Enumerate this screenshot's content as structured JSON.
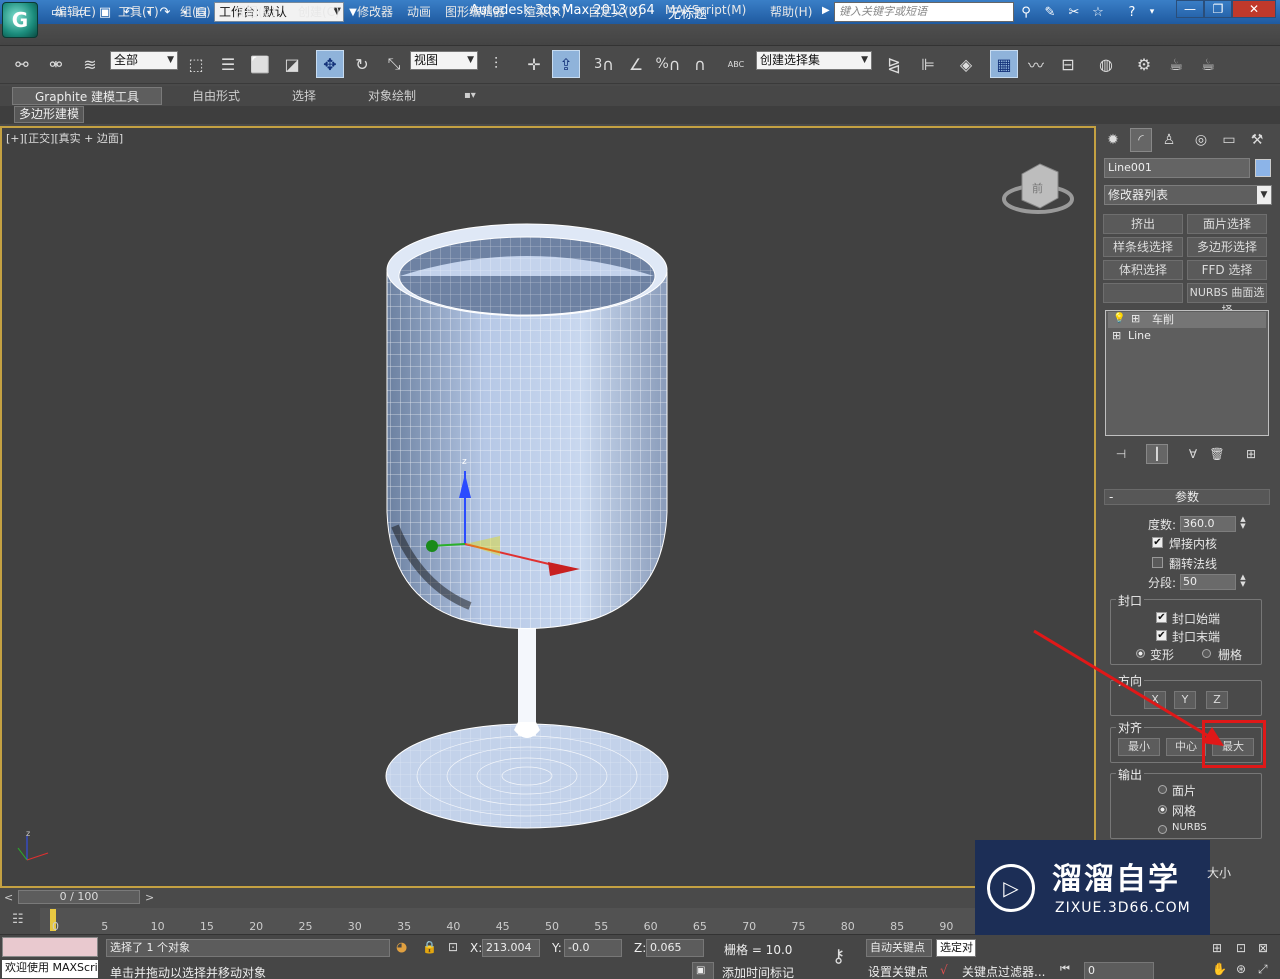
{
  "app": {
    "title": "Autodesk 3ds Max  2013 x64",
    "doc": "无标题",
    "workspace": "工作台: 默认",
    "search_placeholder": "键入关键字或短语",
    "logo": "G"
  },
  "menu": [
    "编辑(E)",
    "工具(T)",
    "组(G)",
    "视图(V)",
    "创建(C)",
    "修改器",
    "动画",
    "图形编辑器",
    "渲染(R)",
    "自定义(U)",
    "MAXScript(M)",
    "帮助(H)"
  ],
  "toolbar": {
    "filter": "全部",
    "coord": "视图",
    "selset": "创建选择集",
    "snap3": "3",
    "percent": "%",
    "spinner_snap": "ABC"
  },
  "ribbon": {
    "tabs": [
      "Graphite 建模工具",
      "自由形式",
      "选择",
      "对象绘制"
    ],
    "sub": "多边形建模",
    "extra": "▪▾"
  },
  "viewport": {
    "label": "[+][正交][真实 + 边面]",
    "viewcube": "前"
  },
  "panel": {
    "object_name": "Line001",
    "modifier_list": "修改器列表",
    "mod_buttons": [
      "挤出",
      "面片选择",
      "样条线选择",
      "多边形选择",
      "体积选择",
      "FFD 选择",
      "",
      "NURBS 曲面选择"
    ],
    "stack": [
      "车削",
      "Line"
    ],
    "rollout": "参数",
    "rollout_toggle": "-",
    "degrees_label": "度数:",
    "degrees": "360.0",
    "weld_core": "焊接内核",
    "flip_normals": "翻转法线",
    "segments_label": "分段:",
    "segments": "50",
    "capping": "封口",
    "cap_start": "封口始端",
    "cap_end": "封口末端",
    "morph": "变形",
    "grid": "栅格",
    "direction": "方向",
    "dir_x": "X",
    "dir_y": "Y",
    "dir_z": "Z",
    "align": "对齐",
    "align_min": "最小",
    "align_center": "中心",
    "align_max": "最大",
    "output": "输出",
    "out_patch": "面片",
    "out_mesh": "网格",
    "out_nurbs": "NURBS",
    "partial": "大小"
  },
  "timeline": {
    "frame": "0 / 100",
    "ticks": [
      "0",
      "5",
      "10",
      "15",
      "20",
      "25",
      "30",
      "35",
      "40",
      "45",
      "50",
      "55",
      "60",
      "65",
      "70",
      "75",
      "80",
      "85",
      "90"
    ]
  },
  "status": {
    "selected": "选择了 1 个对象",
    "hint": "单击并拖动以选择并移动对象",
    "welcome": "欢迎使用 MAXScri",
    "x_label": "X:",
    "x": "213.004",
    "y_label": "Y:",
    "y": "-0.0",
    "z_label": "Z:",
    "z": "0.065",
    "grid": "栅格 = 10.0",
    "auto_key": "自动关键点",
    "set_key": "设置关键点",
    "sel_obj": "选定对",
    "add_tag": "添加时间标记",
    "key_filters": "关键点过滤器...",
    "frame_field": "0"
  },
  "watermark": {
    "title": "溜溜自学",
    "url": "ZIXUE.3D66.COM"
  }
}
